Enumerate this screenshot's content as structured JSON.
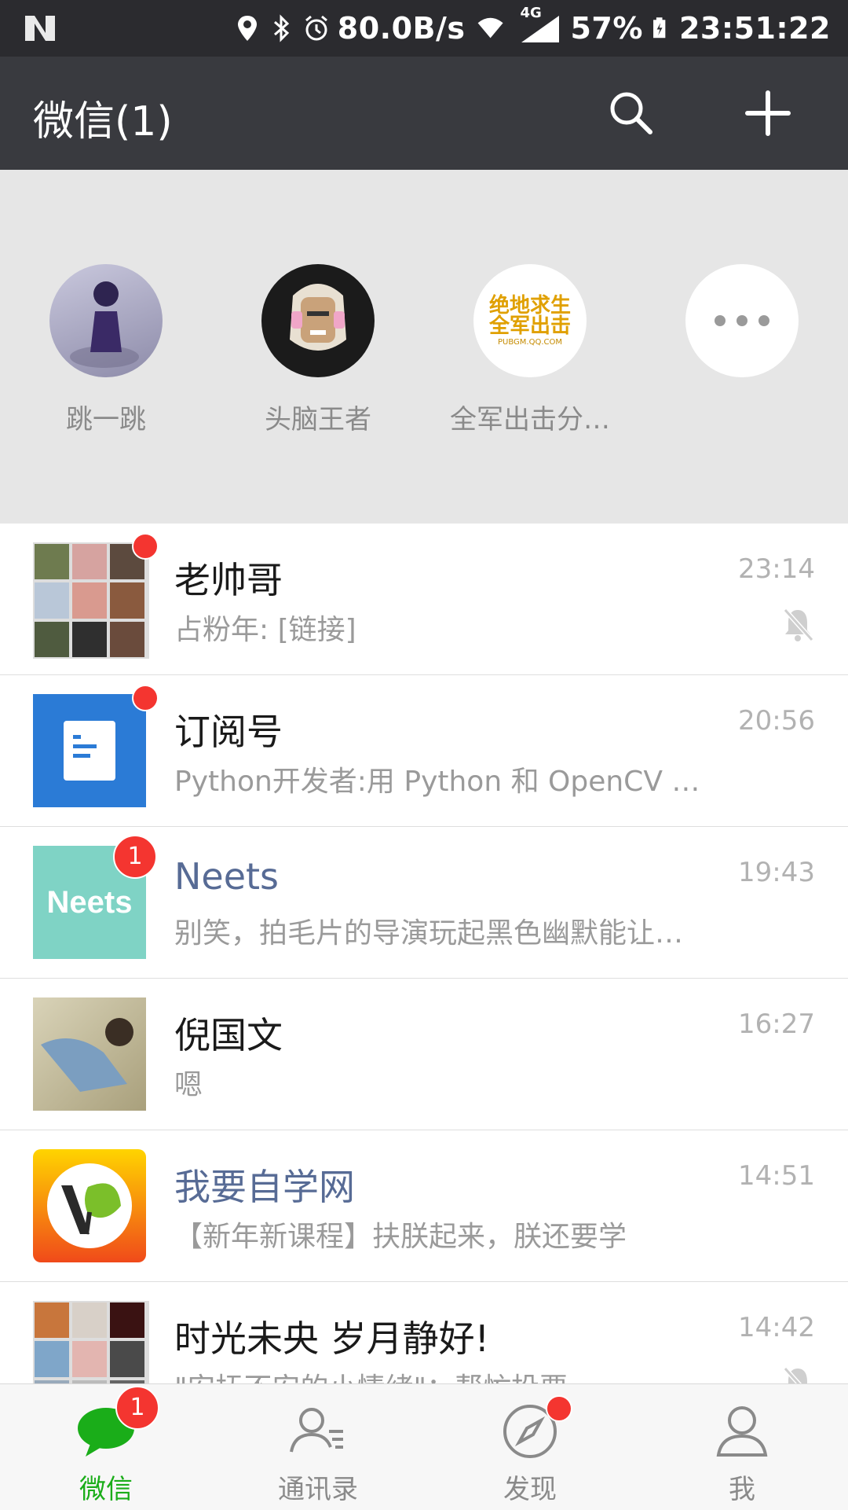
{
  "status_bar": {
    "network_speed": "80.0B/s",
    "network_type": "4G",
    "battery": "57%",
    "time": "23:51:22"
  },
  "header": {
    "title": "微信(1)"
  },
  "mini_programs": [
    {
      "label": "跳一跳"
    },
    {
      "label": "头脑王者"
    },
    {
      "label": "全军出击分…"
    },
    {
      "label": ""
    }
  ],
  "chats": [
    {
      "name": "老帅哥",
      "preview": "占粉年: [链接]",
      "time": "23:14",
      "muted": true,
      "dot": true
    },
    {
      "name": "订阅号",
      "preview": "Python开发者:用 Python 和 OpenCV 检…",
      "time": "20:56",
      "dot": true
    },
    {
      "name": "Neets",
      "preview": "别笑，拍毛片的导演玩起黑色幽默能让…",
      "time": "19:43",
      "badge": "1"
    },
    {
      "name": "倪国文",
      "preview": "嗯",
      "time": "16:27"
    },
    {
      "name": "我要自学网",
      "preview": "【新年新课程】扶朕起来，朕还要学",
      "time": "14:51"
    },
    {
      "name": "时光未央 岁月静好!",
      "preview": "\"安抚不安的小情绪\"：帮忙投票",
      "time": "14:42",
      "muted": true
    }
  ],
  "avatar_texts": {
    "neets": "Neets",
    "pubg_line1": "绝地求生",
    "pubg_line2": "全军出击",
    "pubg_line3": "PUBGM.QQ.COM"
  },
  "tabs": [
    {
      "label": "微信",
      "badge": "1"
    },
    {
      "label": "通讯录"
    },
    {
      "label": "发现"
    },
    {
      "label": "我"
    }
  ],
  "colors": {
    "accent_green": "#1aad19",
    "badge_red": "#f43530",
    "header_bg": "#393a3f",
    "status_bg": "#2b2b2f",
    "link_blue": "#576b95"
  }
}
